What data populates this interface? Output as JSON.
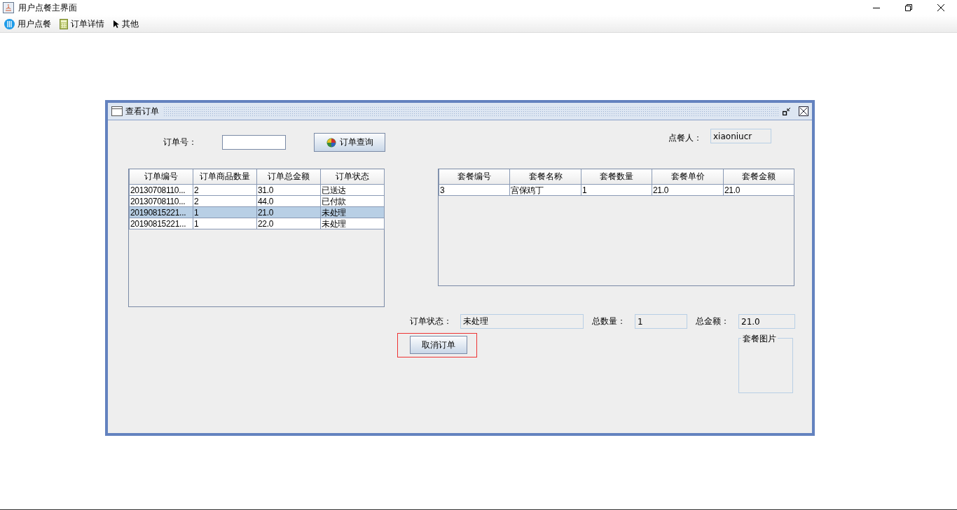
{
  "window": {
    "title": "用户点餐主界面"
  },
  "menu": [
    {
      "label": "用户点餐"
    },
    {
      "label": "订单详情"
    },
    {
      "label": "其他"
    }
  ],
  "internal_frame": {
    "title": "查看订单"
  },
  "order_search": {
    "label": "订单号：",
    "button": "订单查询"
  },
  "customer": {
    "label": "点餐人：",
    "value": "xiaoniucr"
  },
  "orders_table": {
    "columns": [
      "订单编号",
      "订单商品数量",
      "订单总金额",
      "订单状态"
    ],
    "rows": [
      {
        "cells": [
          "20130708110...",
          "2",
          "31.0",
          "已送达"
        ],
        "selected": false
      },
      {
        "cells": [
          "20130708110...",
          "2",
          "44.0",
          "已付款"
        ],
        "selected": false
      },
      {
        "cells": [
          "20190815221...",
          "1",
          "21.0",
          "未处理"
        ],
        "selected": true
      },
      {
        "cells": [
          "20190815221...",
          "1",
          "22.0",
          "未处理"
        ],
        "selected": false
      }
    ]
  },
  "items_table": {
    "columns": [
      "套餐编号",
      "套餐名称",
      "套餐数量",
      "套餐单价",
      "套餐金额"
    ],
    "rows": [
      {
        "cells": [
          "3",
          "宫保鸡丁",
          "1",
          "21.0",
          "21.0"
        ],
        "selected": false
      }
    ]
  },
  "summary": [
    {
      "label": "订单状态：",
      "value": "未处理"
    },
    {
      "label": "总数量：",
      "value": "1"
    },
    {
      "label": "总金额：",
      "value": "21.0"
    }
  ],
  "cancel_button": {
    "label": "取消订单",
    "highlighted": true
  },
  "image_panel": {
    "title": "套餐图片"
  }
}
